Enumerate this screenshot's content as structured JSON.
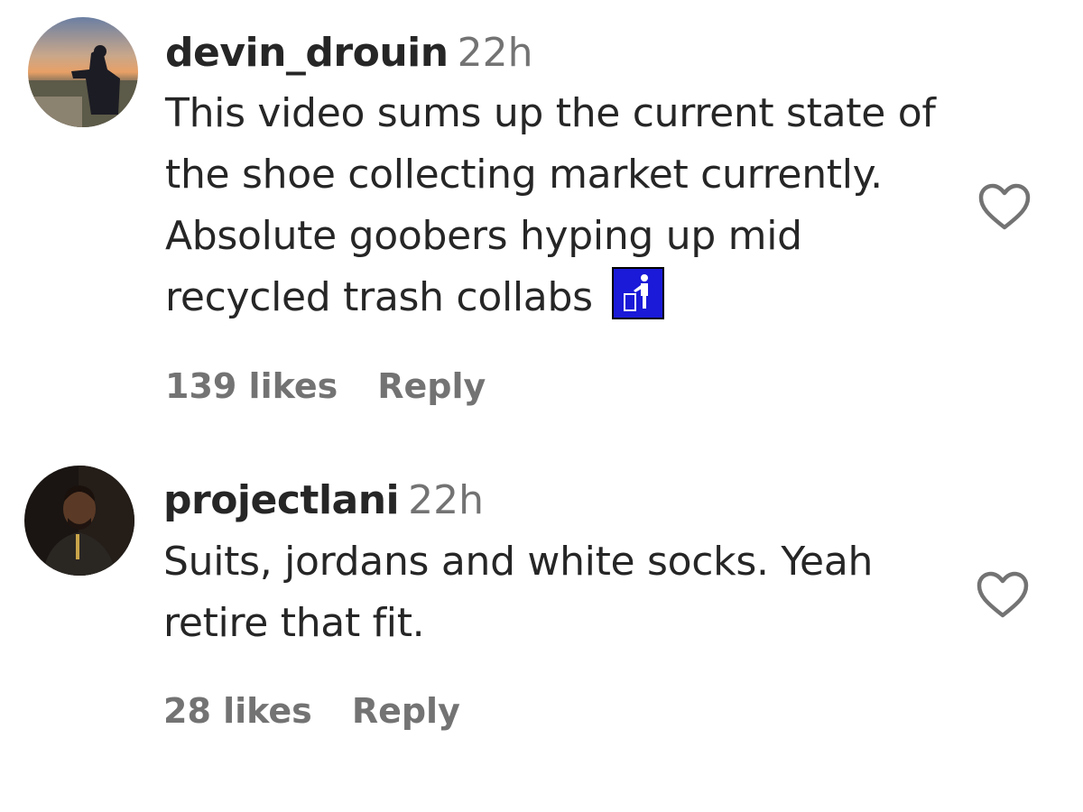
{
  "comments": [
    {
      "username": "devin_drouin",
      "time": "22h",
      "text": "This video sums up the current state of the shoe collecting market currently. Absolute goobers hyping up mid recycled trash collabs",
      "emoji": "put-litter-in-its-place-icon",
      "likes": "139 likes",
      "reply_label": "Reply",
      "like_icon": "heart-outline-icon"
    },
    {
      "username": "projectlani",
      "time": "22h",
      "text": "Suits, jordans and white socks. Yeah retire that fit.",
      "likes": "28 likes",
      "reply_label": "Reply",
      "like_icon": "heart-outline-icon"
    }
  ],
  "colors": {
    "text": "#262626",
    "secondary": "#737373",
    "emoji_bg": "#1a1ad8"
  }
}
